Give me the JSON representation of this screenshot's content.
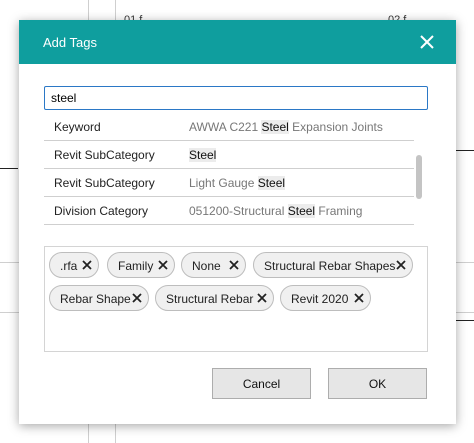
{
  "background": {
    "texts": [
      "01 f",
      "02 f"
    ]
  },
  "dialog": {
    "title": "Add Tags",
    "search": {
      "value": "steel",
      "placeholder": ""
    },
    "results": [
      {
        "category": "Keyword",
        "before": "AWWA C221 ",
        "match": "Steel",
        "after": " Expansion Joints"
      },
      {
        "category": "Revit SubCategory",
        "before": "",
        "match": "Steel",
        "after": ""
      },
      {
        "category": "Revit SubCategory",
        "before": "Light Gauge ",
        "match": "Steel",
        "after": ""
      },
      {
        "category": "Division Category",
        "before": "051200-Structural ",
        "match": "Steel",
        "after": " Framing"
      }
    ],
    "tags": [
      ".rfa",
      "Family",
      "None",
      "Structural Rebar Shapes",
      "Rebar Shape",
      "Structural Rebar",
      "Revit 2020"
    ],
    "buttons": {
      "cancel": "Cancel",
      "ok": "OK"
    },
    "colors": {
      "titlebar": "#0f9e9e",
      "focus_border": "#2b78c6"
    }
  }
}
